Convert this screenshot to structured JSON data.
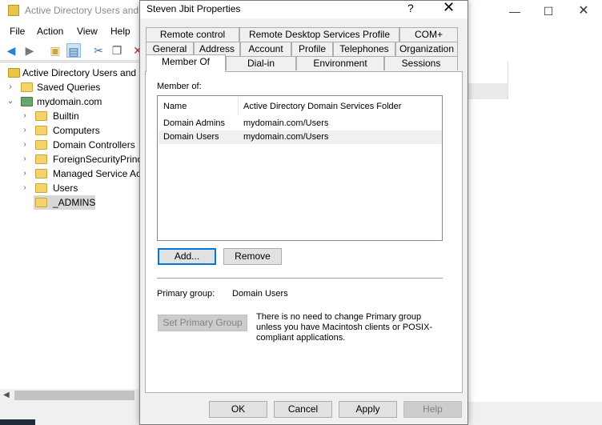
{
  "mmc": {
    "title": "Active Directory Users and C",
    "menu": [
      "File",
      "Action",
      "View",
      "Help"
    ],
    "tree": {
      "root": "Active Directory Users and C",
      "saved_queries": "Saved Queries",
      "domain": "mydomain.com",
      "children": [
        "Builtin",
        "Computers",
        "Domain Controllers",
        "ForeignSecurityPrinc",
        "Managed Service Ac",
        "Users",
        "_ADMINS"
      ]
    }
  },
  "dialog": {
    "title": "Steven Jbit Properties",
    "help": "?",
    "close": "✕",
    "tabs_row1": [
      "Remote control",
      "Remote Desktop Services Profile",
      "COM+"
    ],
    "tabs_row2": [
      "General",
      "Address",
      "Account",
      "Profile",
      "Telephones",
      "Organization"
    ],
    "tabs_row3": [
      "Member Of",
      "Dial-in",
      "Environment",
      "Sessions"
    ],
    "active_tab": "Member Of",
    "member_of_label": "Member of:",
    "columns": [
      "Name",
      "Active Directory Domain Services Folder"
    ],
    "rows": [
      {
        "name": "Domain Admins",
        "folder": "mydomain.com/Users"
      },
      {
        "name": "Domain Users",
        "folder": "mydomain.com/Users"
      }
    ],
    "add_label": "Add...",
    "remove_label": "Remove",
    "primary_group_label": "Primary group:",
    "primary_group_value": "Domain Users",
    "set_primary_label": "Set Primary Group",
    "info_text": "There is no need to change Primary group unless you have Macintosh clients or POSIX-compliant applications.",
    "ok_label": "OK",
    "cancel_label": "Cancel",
    "apply_label": "Apply",
    "help_label": "Help"
  },
  "colors": {
    "accent": "#0078d7",
    "dialog_bg": "#f0f0f0",
    "folder": "#f3d36a"
  }
}
